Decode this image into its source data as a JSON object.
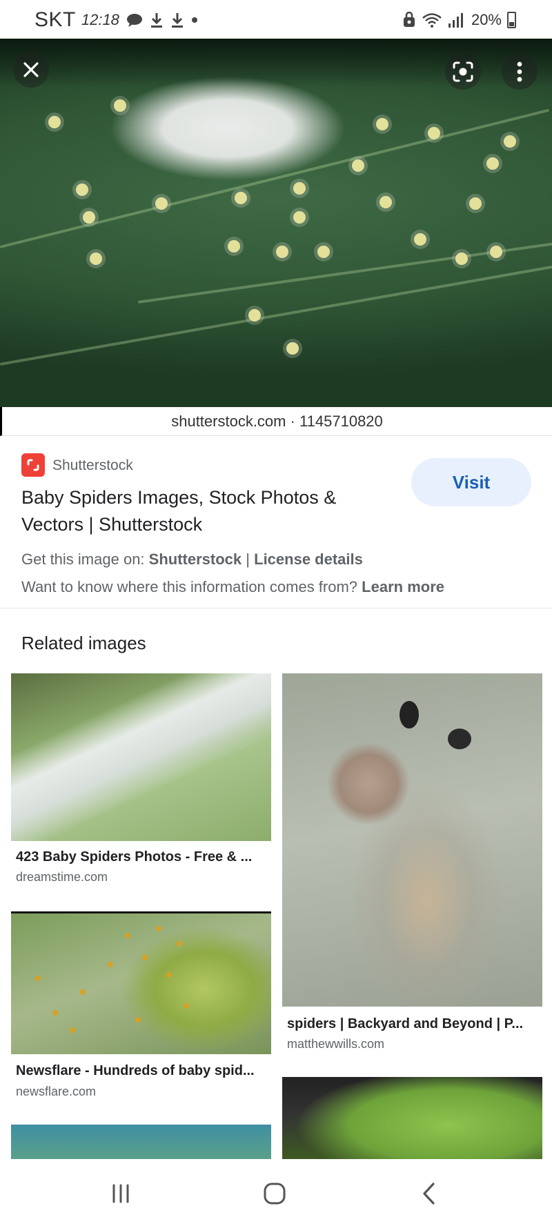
{
  "status_bar": {
    "carrier": "SKT",
    "time": "12:18",
    "battery": "20%"
  },
  "hero": {
    "source_caption": "shutterstock.com · 1145710820"
  },
  "result": {
    "site_name": "Shutterstock",
    "title": "Baby Spiders Images, Stock Photos & Vectors | Shutterstock",
    "visit_label": "Visit",
    "license_prefix": "Get this image on:",
    "license_site": "Shutterstock",
    "license_separator": "|",
    "license_details": "License details",
    "info_question": "Want to know where this information comes from?",
    "learn_more": "Learn more"
  },
  "related": {
    "heading": "Related images",
    "items": [
      {
        "title": "423 Baby Spiders Photos - Free & ...",
        "domain": "dreamstime.com"
      },
      {
        "title": "spiders | Backyard and Beyond | P...",
        "domain": "matthewwills.com"
      },
      {
        "title": "Newsflare - Hundreds of baby spid...",
        "domain": "newsflare.com"
      }
    ]
  },
  "colors": {
    "visit_bg": "#e8f0fe",
    "visit_text": "#1a5fb4",
    "favicon": "#ee4137"
  },
  "icons": {
    "close": "close-icon",
    "lens": "lens-icon",
    "more": "more-vert-icon",
    "nav_recent": "recent-apps-icon",
    "nav_home": "home-icon",
    "nav_back": "back-icon"
  }
}
